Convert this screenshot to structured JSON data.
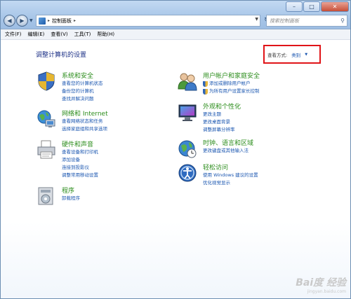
{
  "window": {
    "caption": {
      "minimize": "–",
      "maximize": "□",
      "close": "✕"
    }
  },
  "address": {
    "separator": "▸",
    "crumb": "控制面板",
    "search_placeholder": "搜索控制面板"
  },
  "menu": [
    "文件(F)",
    "编辑(E)",
    "查看(V)",
    "工具(T)",
    "帮助(H)"
  ],
  "page": {
    "title": "调整计算机的设置",
    "view_by_label": "查看方式:",
    "view_by_value": "类别",
    "view_by_highlight_color": "#e01418"
  },
  "categories_left": [
    {
      "title": "系统和安全",
      "icon": "shield-icon",
      "links": [
        "查看您的计算机状态",
        "备份您的计算机",
        "查找并解决问题"
      ]
    },
    {
      "title": "网络和 Internet",
      "icon": "network-icon",
      "links": [
        "查看网络状态和任务",
        "选择家庭组和共享选项"
      ]
    },
    {
      "title": "硬件和声音",
      "icon": "printer-icon",
      "links": [
        "查看设备和打印机",
        "添加设备",
        "连接到投影仪",
        "调整常用移动设置"
      ]
    },
    {
      "title": "程序",
      "icon": "programs-icon",
      "links": [
        "卸载程序"
      ]
    }
  ],
  "categories_right": [
    {
      "title": "用户帐户和家庭安全",
      "icon": "users-icon",
      "links": [
        "添加或删除用户帐户",
        "为所有用户设置家长控制"
      ]
    },
    {
      "title": "外观和个性化",
      "icon": "display-icon",
      "links": [
        "更改主题",
        "更改桌面背景",
        "调整屏幕分辨率"
      ]
    },
    {
      "title": "时钟、语言和区域",
      "icon": "globe-clock-icon",
      "links": [
        "更改键盘或其他输入法"
      ]
    },
    {
      "title": "轻松访问",
      "icon": "ease-of-access-icon",
      "links": [
        "使用 Windows 建议的设置",
        "优化视觉显示"
      ]
    }
  ],
  "colors": {
    "category_title": "#2c8d1c",
    "link": "#1a56b0",
    "page_title": "#1e3287"
  }
}
